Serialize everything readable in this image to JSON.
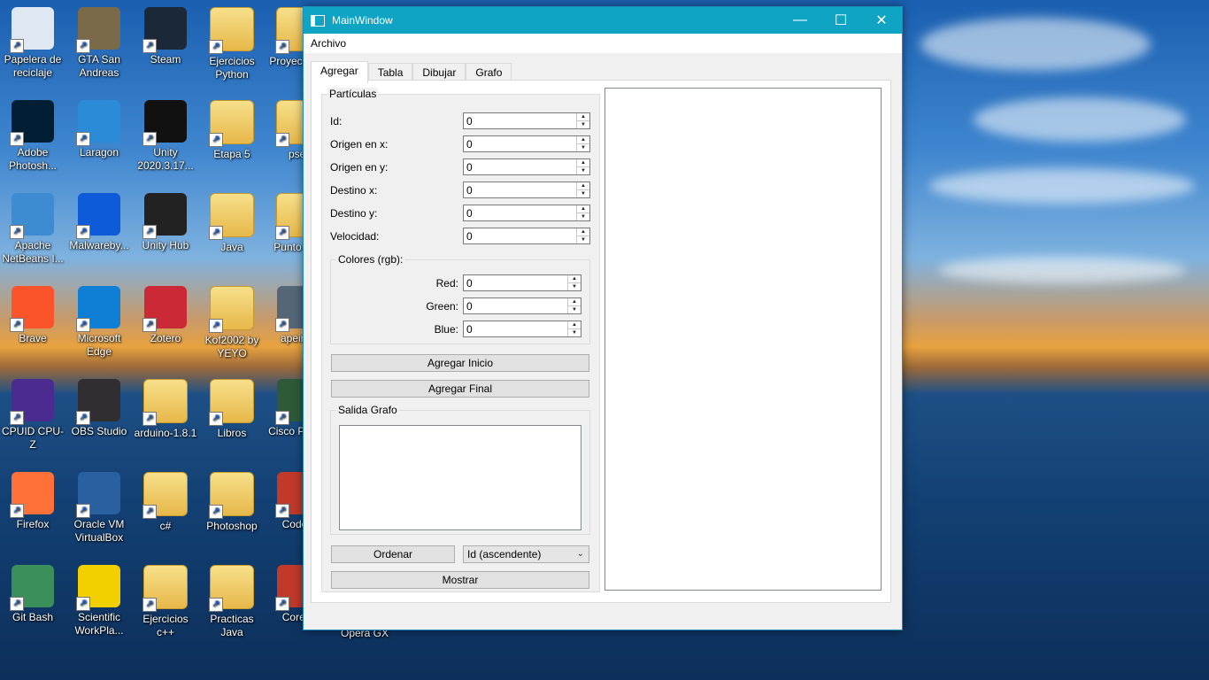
{
  "desktop": {
    "icons": [
      {
        "label": "Papelera de reciclaje",
        "color": "#dfe8f2"
      },
      {
        "label": "GTA San Andreas",
        "color": "#7a6a4a"
      },
      {
        "label": "Steam",
        "color": "#1b2838"
      },
      {
        "label": "Ejercicios Python",
        "color": "folder"
      },
      {
        "label": "Proyec y Re",
        "color": "folder"
      },
      {
        "label": "Adobe Photosh...",
        "color": "#001e36"
      },
      {
        "label": "Laragon",
        "color": "#2b8bd6"
      },
      {
        "label": "Unity 2020.3.17...",
        "color": "#111111"
      },
      {
        "label": "Etapa 5",
        "color": "folder"
      },
      {
        "label": "psei",
        "color": "folder"
      },
      {
        "label": "Apache NetBeans I...",
        "color": "#3d8bd0"
      },
      {
        "label": "Malwareby...",
        "color": "#0d5bd8"
      },
      {
        "label": "Unity Hub",
        "color": "#222222"
      },
      {
        "label": "Java",
        "color": "folder"
      },
      {
        "label": "Punto Ven",
        "color": "folder"
      },
      {
        "label": "Brave",
        "color": "#fb542b"
      },
      {
        "label": "Microsoft Edge",
        "color": "#0f7fd6"
      },
      {
        "label": "Zotero",
        "color": "#cc2936"
      },
      {
        "label": "Kof2002 by YEYO",
        "color": "folder"
      },
      {
        "label": "apeiron",
        "color": "#556677"
      },
      {
        "label": "CPUID CPU-Z",
        "color": "#4b2b8f"
      },
      {
        "label": "OBS Studio",
        "color": "#302e31"
      },
      {
        "label": "arduino-1.8.1",
        "color": "folder"
      },
      {
        "label": "Libros",
        "color": "folder"
      },
      {
        "label": "Cisco P Trac",
        "color": "#2e5a3a"
      },
      {
        "label": "Firefox",
        "color": "#ff7139"
      },
      {
        "label": "Oracle VM VirtualBox",
        "color": "#2a5fa0"
      },
      {
        "label": "c#",
        "color": "folder"
      },
      {
        "label": "Photoshop",
        "color": "folder"
      },
      {
        "label": "CodeB",
        "color": "#c0392b"
      },
      {
        "label": "Git Bash",
        "color": "#3a8f5a"
      },
      {
        "label": "Scientific WorkPla...",
        "color": "#f2d000"
      },
      {
        "label": "Ejercicios c++",
        "color": "folder"
      },
      {
        "label": "Practicas Java",
        "color": "folder"
      },
      {
        "label": "Core T",
        "color": "#c0392b"
      }
    ],
    "opera_label": "Opera GX"
  },
  "window": {
    "title": "MainWindow",
    "controls": {
      "minimize": "—",
      "maximize": "☐",
      "close": "✕"
    },
    "menu": [
      "Archivo"
    ],
    "tabs": [
      "Agregar",
      "Tabla",
      "Dibujar",
      "Grafo"
    ],
    "particulas": {
      "title": "Partículas",
      "fields": [
        {
          "label": "Id:",
          "value": "0"
        },
        {
          "label": "Origen en x:",
          "value": "0"
        },
        {
          "label": "Origen en y:",
          "value": "0"
        },
        {
          "label": "Destino x:",
          "value": "0"
        },
        {
          "label": "Destino y:",
          "value": "0"
        },
        {
          "label": "Velocidad:",
          "value": "0"
        }
      ],
      "colores": {
        "title": "Colores (rgb):",
        "fields": [
          {
            "label": "Red:",
            "value": "0"
          },
          {
            "label": "Green:",
            "value": "0"
          },
          {
            "label": "Blue:",
            "value": "0"
          }
        ]
      },
      "agregar_inicio": "Agregar Inicio",
      "agregar_final": "Agregar Final",
      "salida_grafo": "Salida Grafo",
      "ordenar": "Ordenar",
      "sort_option": "Id (ascendente)",
      "mostrar": "Mostrar"
    }
  }
}
